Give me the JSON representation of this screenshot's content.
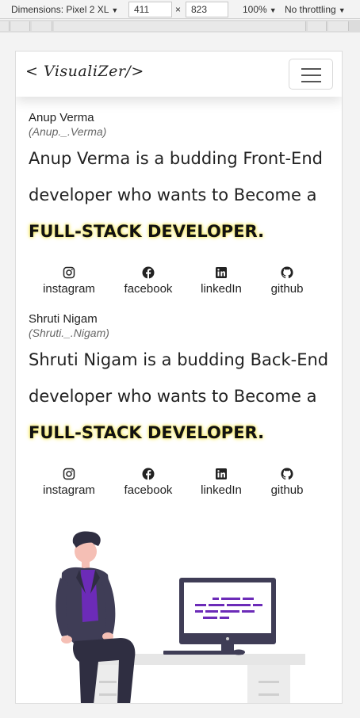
{
  "devtools": {
    "dimensions_label": "Dimensions: Pixel 2 XL",
    "width": "411",
    "times": "×",
    "height": "823",
    "zoom": "100%",
    "throttling": "No throttling"
  },
  "navbar": {
    "brand": "< VisualiZer/>"
  },
  "profiles": [
    {
      "name": "Anup Verma",
      "handle": "(Anup._.Verma)",
      "bio_text": "Anup Verma is a budding Front-End developer who wants to Become a",
      "highlight": "FULL-STACK DEVELOPER."
    },
    {
      "name": "Shruti Nigam",
      "handle": "(Shruti._.Nigam)",
      "bio_text": "Shruti Nigam is a budding Back-End developer who wants to Become a",
      "highlight": "FULL-STACK DEVELOPER."
    }
  ],
  "social_links": [
    {
      "label": "instagram",
      "icon": "instagram-icon"
    },
    {
      "label": "facebook",
      "icon": "facebook-icon"
    },
    {
      "label": "linkedIn",
      "icon": "linkedin-icon"
    },
    {
      "label": "github",
      "icon": "github-icon"
    }
  ],
  "colors": {
    "highlight": "#f5e85a",
    "illustration_accent": "#6c2bb8",
    "illustration_dark": "#3f3d56"
  }
}
